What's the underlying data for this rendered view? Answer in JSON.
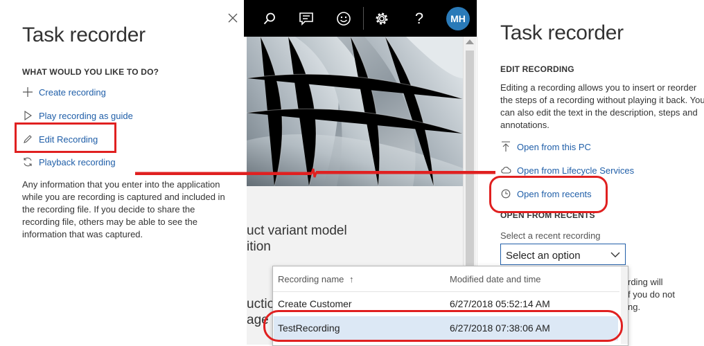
{
  "left_pane": {
    "title": "Task recorder",
    "section_heading": "WHAT WOULD YOU LIKE TO DO?",
    "actions": [
      {
        "label": "Create recording",
        "icon": "plus-icon"
      },
      {
        "label": "Play recording as guide",
        "icon": "play-icon"
      },
      {
        "label": "Edit Recording",
        "icon": "pencil-icon"
      },
      {
        "label": "Playback recording",
        "icon": "refresh-icon"
      }
    ],
    "description": "Any information that you enter into the application while you are recording is captured and included in the recording file. If you decide to share the recording file, others may be able to see the information that was captured."
  },
  "topbar": {
    "icons": [
      "search-icon",
      "chat-icon",
      "smiley-icon",
      "gear-icon",
      "help-icon"
    ],
    "help_glyph": "?",
    "avatar_initials": "MH"
  },
  "middle": {
    "tile1_text": "uct variant model\nition",
    "tile2_text": "uctio\nage"
  },
  "right_pane": {
    "title": "Task recorder",
    "section_heading": "EDIT RECORDING",
    "description": "Editing a recording allows you to insert or reorder the steps of a recording without playing it back. You can also edit the text in the description, steps and annotations.",
    "options": [
      {
        "label": "Open from this PC",
        "icon": "upload-icon"
      },
      {
        "label": "Open from Lifecycle Services",
        "icon": "cloud-icon"
      },
      {
        "label": "Open from recents",
        "icon": "clock-icon"
      }
    ],
    "recents_heading": "OPEN FROM RECENTS",
    "select_label": "Select a recent recording",
    "select_value": "Select an option",
    "cut_text_1": "rding will",
    "cut_text_2": "f you do not",
    "cut_text_3": "ng."
  },
  "dropdown": {
    "columns": [
      "Recording name",
      "Modified date and time"
    ],
    "sort_glyph": "↑",
    "rows": [
      {
        "name": "Create Customer",
        "modified": "6/27/2018 05:52:14 AM",
        "selected": false
      },
      {
        "name": "TestRecording",
        "modified": "6/27/2018 07:38:06 AM",
        "selected": true
      }
    ]
  },
  "colors": {
    "link_blue": "#1f5ea8",
    "annotation_red": "#e02020",
    "avatar_blue": "#2a7ab8",
    "selected_row": "#dce8f5"
  }
}
